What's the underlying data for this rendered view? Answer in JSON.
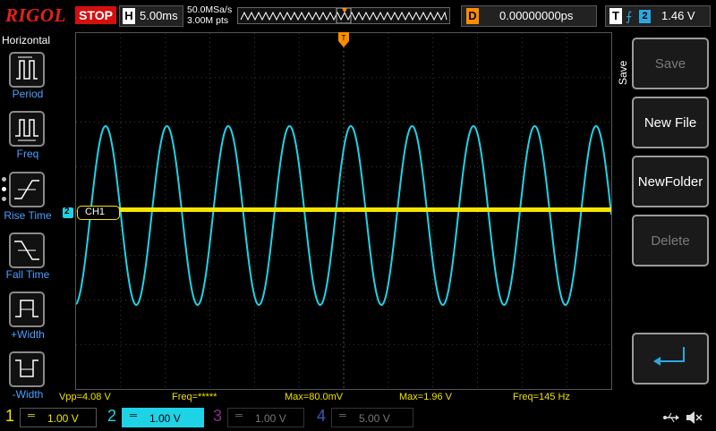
{
  "header": {
    "logo": "RIGOL",
    "run_state": "STOP",
    "timebase_label": "H",
    "timebase_value": "5.00ms",
    "sample_rate": "50.0MSa/s",
    "memory_depth": "3.00M pts",
    "delay_label": "D",
    "delay_value": "0.00000000ps",
    "trigger_label": "T",
    "trigger_source": "2",
    "trigger_level": "1.46 V"
  },
  "left_panel": {
    "title": "Horizontal",
    "items": [
      {
        "label": "Period",
        "icon": "period-icon"
      },
      {
        "label": "Freq",
        "icon": "freq-icon"
      },
      {
        "label": "Rise Time",
        "icon": "rise-time-icon"
      },
      {
        "label": "Fall Time",
        "icon": "fall-time-icon"
      },
      {
        "label": "+Width",
        "icon": "positive-width-icon"
      },
      {
        "label": "-Width",
        "icon": "negative-width-icon"
      }
    ]
  },
  "right_panel": {
    "title": "Save",
    "buttons": [
      {
        "label": "Save",
        "enabled": false
      },
      {
        "label": "New File",
        "enabled": true
      },
      {
        "label": "NewFolder",
        "enabled": true
      },
      {
        "label": "Delete",
        "enabled": false
      }
    ],
    "return_icon": "return-arrow-icon"
  },
  "waveforms": {
    "ch1_label": "CH1",
    "ch1_color": "#f5e400",
    "ch2_color": "#1ed3e6",
    "ch2_marker": "2"
  },
  "measurements": {
    "vpp": "Vpp=4.08 V",
    "freq_ch1": "Freq=*****",
    "max_ch1": "Max=80.0mV",
    "max_ch2": "Max=1.96 V",
    "freq_ch2": "Freq=145 Hz"
  },
  "channels": [
    {
      "num": "1",
      "scale": "1.00 V",
      "color": "#f5e400",
      "active": true
    },
    {
      "num": "2",
      "scale": "1.00 V",
      "color": "#1ed3e6",
      "active": true
    },
    {
      "num": "3",
      "scale": "1.00 V",
      "color": "#c020c0",
      "active": false
    },
    {
      "num": "4",
      "scale": "5.00 V",
      "color": "#3070ff",
      "active": false
    }
  ],
  "status_icons": [
    "usb-icon",
    "mute-icon"
  ]
}
